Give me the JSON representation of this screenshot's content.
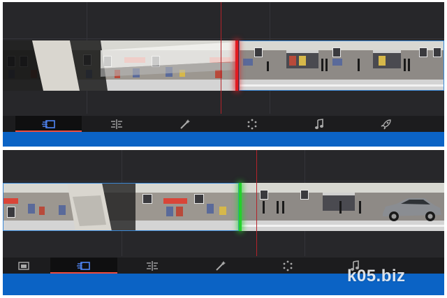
{
  "colors": {
    "panel_bg": "#27272a",
    "track_bg": "#1d1d1f",
    "playhead": "#b4232a",
    "handle_red": "#e21b22",
    "handle_green": "#24d12c",
    "active_tab_underline": "#f04c3e",
    "bottom_bar": "#0b63c5",
    "clip_outline": "#3a89d8"
  },
  "top_panel": {
    "toolbar": [
      {
        "icon": "cut-page-icon",
        "active": true
      },
      {
        "icon": "audio-levels-icon",
        "active": false
      },
      {
        "icon": "effects-wand-icon",
        "active": false
      },
      {
        "icon": "color-dots-icon",
        "active": false
      },
      {
        "icon": "music-note-icon",
        "active": false
      },
      {
        "icon": "rocket-deliver-icon",
        "active": false
      }
    ]
  },
  "bottom_panel": {
    "toolbar": [
      {
        "icon": "media-pool-icon",
        "active": false
      },
      {
        "icon": "cut-page-icon",
        "active": true
      },
      {
        "icon": "audio-levels-icon",
        "active": false
      },
      {
        "icon": "effects-wand-icon",
        "active": false
      },
      {
        "icon": "color-dots-icon",
        "active": false
      },
      {
        "icon": "music-note-icon",
        "active": false
      }
    ]
  },
  "watermark": {
    "text": "k05.biz"
  }
}
